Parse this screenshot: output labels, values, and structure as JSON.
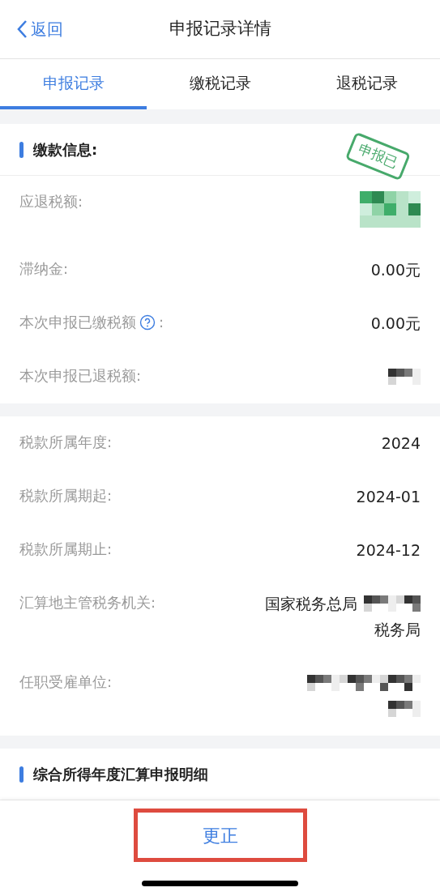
{
  "nav": {
    "back": "返回",
    "title": "申报记录详情"
  },
  "tabs": [
    {
      "label": "申报记录",
      "selected": true
    },
    {
      "label": "缴税记录",
      "selected": false
    },
    {
      "label": "退税记录",
      "selected": false
    }
  ],
  "sections": [
    {
      "title": "缴款信息:",
      "stamp": "申报已",
      "rows": [
        {
          "label": "应退税额:",
          "help_icon": false,
          "lines": [
            [
              {
                "kind": "redacted"
              }
            ]
          ]
        },
        {
          "label": "滞纳金:",
          "help_icon": false,
          "lines": [
            [
              {
                "kind": "text",
                "text": "0.00元"
              }
            ]
          ]
        },
        {
          "label": "本次申报已缴税额",
          "help_icon": true,
          "suffix": ":",
          "lines": [
            [
              {
                "kind": "text",
                "text": "0.00元"
              }
            ]
          ]
        },
        {
          "label": "本次申报已退税额:",
          "help_icon": false,
          "lines": [
            [
              {
                "kind": "redacted"
              }
            ]
          ]
        }
      ]
    },
    {
      "rows": [
        {
          "label": "税款所属年度:",
          "help_icon": false,
          "lines": [
            [
              {
                "kind": "text",
                "text": "2024"
              }
            ]
          ]
        },
        {
          "label": "税款所属期起:",
          "help_icon": false,
          "lines": [
            [
              {
                "kind": "text",
                "text": "2024-01"
              }
            ]
          ]
        },
        {
          "label": "税款所属期止:",
          "help_icon": false,
          "lines": [
            [
              {
                "kind": "text",
                "text": "2024-12"
              }
            ]
          ]
        },
        {
          "label": "汇算地主管税务机关:",
          "help_icon": false,
          "lines": [
            [
              {
                "kind": "text",
                "text": "国家税务总局"
              },
              {
                "kind": "redacted"
              }
            ],
            [
              {
                "kind": "text",
                "text": "税务局"
              }
            ]
          ]
        },
        {
          "label": "任职受雇单位:",
          "help_icon": false,
          "lines": [
            [
              {
                "kind": "redacted"
              }
            ],
            [
              {
                "kind": "redacted"
              }
            ]
          ]
        }
      ]
    },
    {
      "title": "综合所得年度汇算申报明细"
    }
  ],
  "footer": {
    "button": "更正",
    "highlighted": true
  }
}
